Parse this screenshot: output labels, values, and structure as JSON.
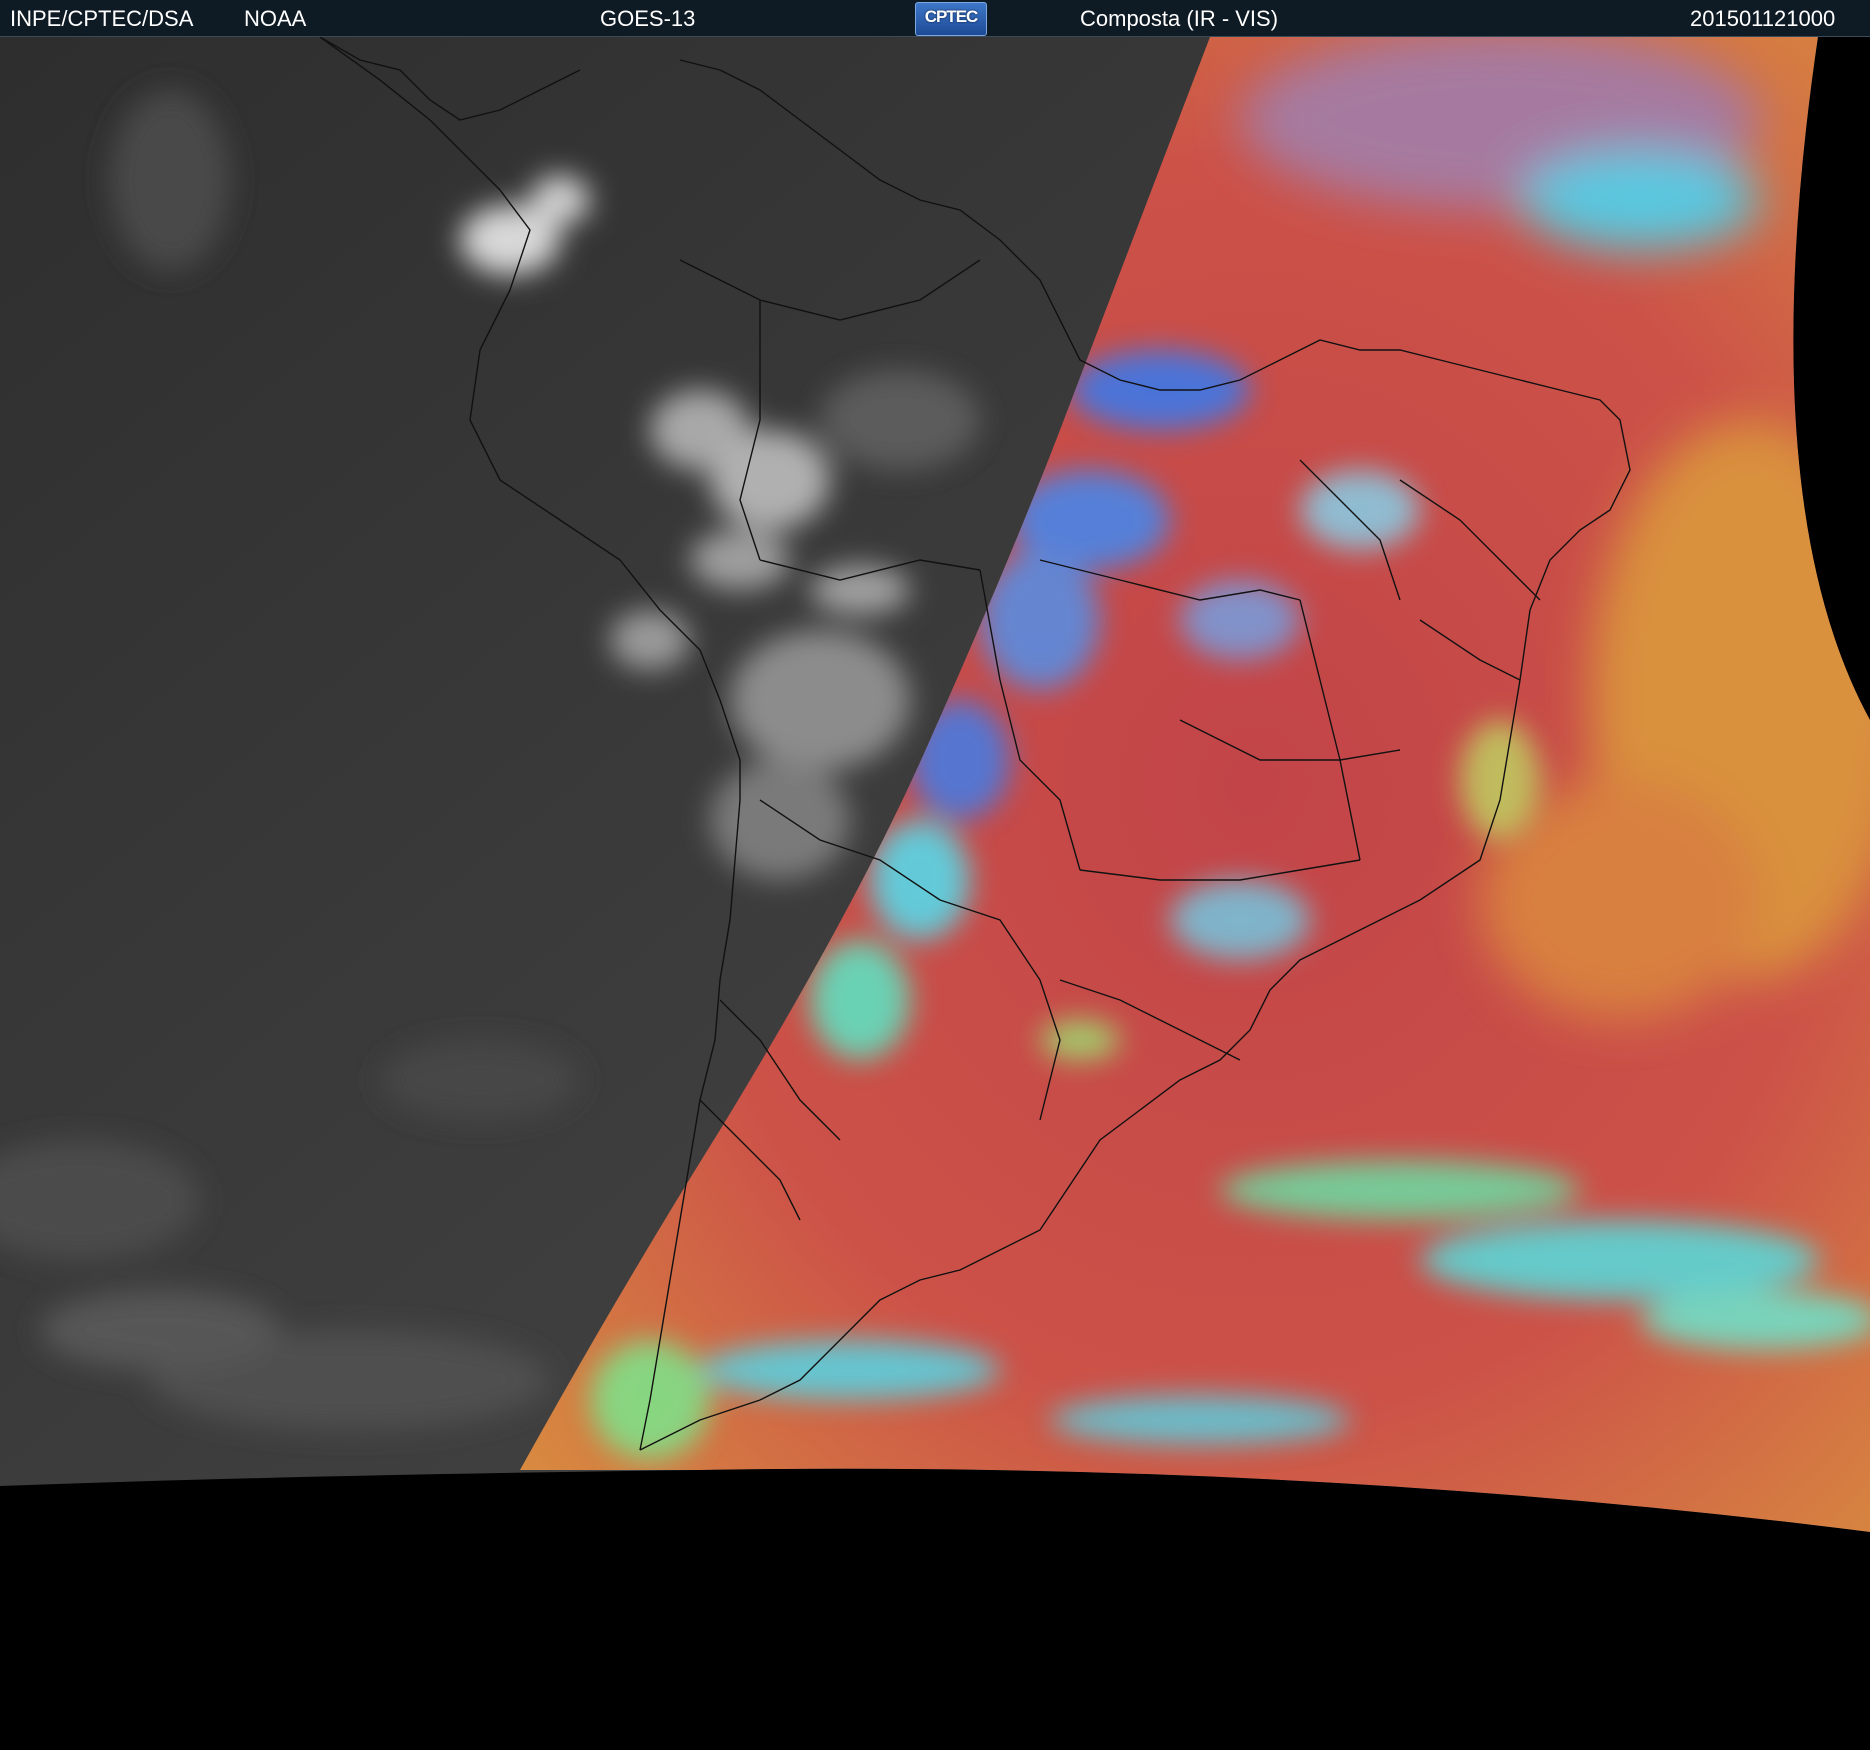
{
  "header": {
    "agency": "INPE/CPTEC/DSA",
    "provider": "NOAA",
    "satellite": "GOES-13",
    "logo_text": "CPTEC",
    "product": "Composta (IR - VIS)",
    "timestamp": "201501121000"
  },
  "colors": {
    "header_background": "#0e1a24",
    "space_background": "#000000",
    "night_ir_gray": "#3a3a3a",
    "day_composite_red": "#c9474a",
    "day_composite_orange": "#d9833e",
    "cloud_cyan": "#58d8e6",
    "cloud_green": "#7ee07a",
    "cloud_blue": "#3c78e6",
    "boundary_lines": "#111111"
  }
}
